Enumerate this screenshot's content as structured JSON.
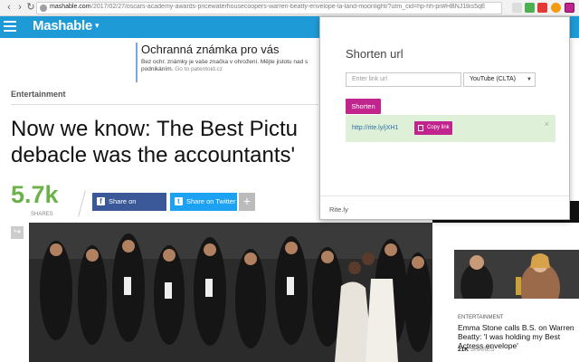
{
  "browser": {
    "url_host": "mashable.com",
    "url_path": "/2017/02/27/oscars-academy-awards-pricewaterhousecoopers-warren-beatty-envelope-la-land-moonlight/?utm_cid=hp-hh-pri#HBNJ1tks5qE"
  },
  "site": {
    "logo": "Mashable",
    "caret": "▾"
  },
  "ad": {
    "title": "Ochranná známka pro vás",
    "body": "Bez ochr. známky je vaše značka v ohrožení. Mějte jistotu nad s",
    "body2": "podnikáním.",
    "link": "Go to patentoid.cz"
  },
  "article": {
    "section": "Entertainment",
    "headline_line1": "Now we know: The Best Pictu",
    "headline_line2": "debacle was the accountants'",
    "shares_count": "5.7k",
    "shares_label": "SHARES",
    "facebook_label": "Share on Facebook",
    "twitter_label": "Share on Twitter",
    "more_label": "+"
  },
  "sidebar": {
    "category": "ENTERTAINMENT",
    "title": "Emma Stone calls B.S. on Warren Beatty: 'I was holding my Best Actress envelope'",
    "shares_count": "21K",
    "shares_label": "SHARES"
  },
  "popup": {
    "title": "Shorten url",
    "link_placeholder": "Enter link url",
    "service_selected": "YouTube (CLTA)",
    "shorten_label": "Shorten",
    "result_link": "http://rite.ly/jXH1",
    "copy_label": "Copy link",
    "close": "×",
    "footer": "Rite.ly"
  },
  "colors": {
    "header_blue": "#1e9ad6",
    "shares_green": "#6cb14a",
    "facebook": "#3b5998",
    "twitter": "#1da1f2",
    "accent_magenta": "#c2248e",
    "success_bg": "#dff0d8"
  }
}
